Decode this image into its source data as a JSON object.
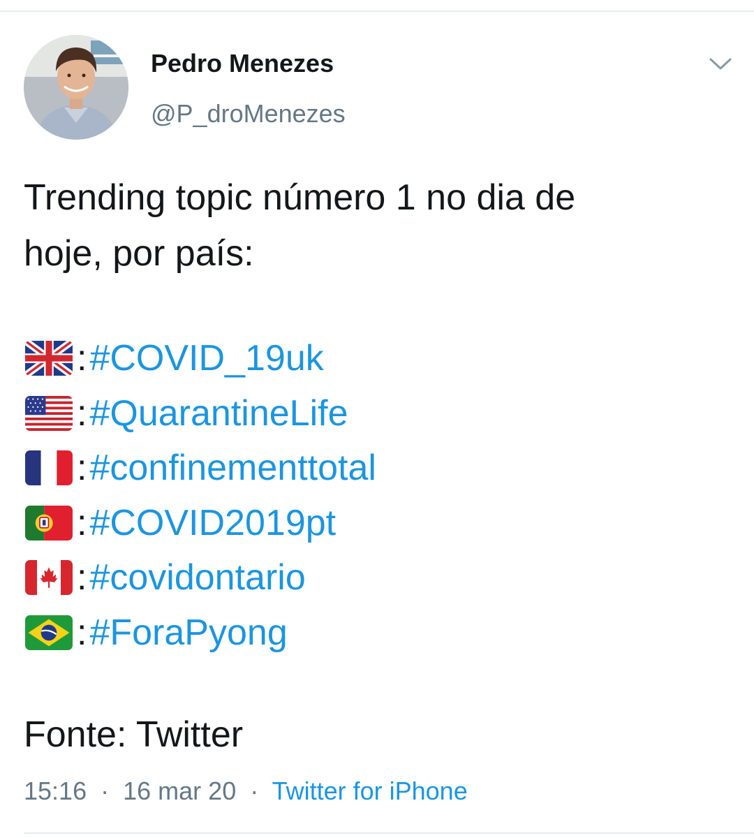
{
  "author": {
    "display_name": "Pedro Menezes",
    "handle": "@P_droMenezes"
  },
  "tweet": {
    "text_line1": "Trending topic número 1 no dia de",
    "text_line2": "hoje, por país:",
    "trends": [
      {
        "flag": "uk-flag-icon",
        "separator": ":",
        "hashtag": "#COVID_19uk"
      },
      {
        "flag": "us-flag-icon",
        "separator": ":",
        "hashtag": "#QuarantineLife"
      },
      {
        "flag": "france-flag-icon",
        "separator": ":",
        "hashtag": "#confinementtotal"
      },
      {
        "flag": "portugal-flag-icon",
        "separator": ":",
        "hashtag": "#COVID2019pt"
      },
      {
        "flag": "canada-flag-icon",
        "separator": ":",
        "hashtag": "#covidontario"
      },
      {
        "flag": "brazil-flag-icon",
        "separator": ":",
        "hashtag": "#ForaPyong"
      }
    ],
    "source_line": "Fonte: Twitter"
  },
  "meta": {
    "time": "15:16",
    "separator": "·",
    "date": "16 mar 20",
    "client": "Twitter for iPhone"
  },
  "colors": {
    "link": "#1b95e0",
    "text": "#14171a",
    "muted": "#657786"
  }
}
